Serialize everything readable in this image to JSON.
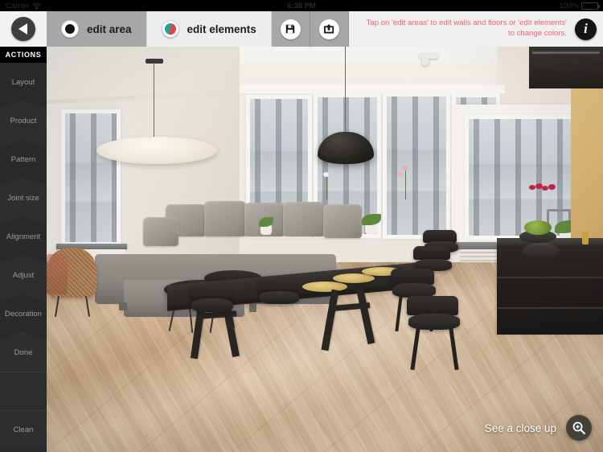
{
  "status_bar": {
    "carrier": "Carrier",
    "wifi_icon": "wifi-icon",
    "time": "6:38 PM",
    "battery_percent": "100%",
    "battery_icon": "battery-full-icon"
  },
  "toolbar": {
    "back_icon": "back-arrow-icon",
    "tabs": [
      {
        "label": "edit area",
        "icon": "black-dot-icon",
        "active": true
      },
      {
        "label": "edit elements",
        "icon": "color-wheel-icon",
        "active": false
      }
    ],
    "save_icon": "floppy-save-icon",
    "share_icon": "share-export-icon",
    "hint": "Tap on 'edit areas' to edit walls and floors or 'edit elements' to change colors.",
    "info_icon": "info-icon",
    "info_label": "i"
  },
  "sidebar": {
    "header": "ACTIONS",
    "items": [
      {
        "label": "Layout",
        "shape": "chevron"
      },
      {
        "label": "Product",
        "shape": "chevron"
      },
      {
        "label": "Pattern",
        "shape": "chevron"
      },
      {
        "label": "Joint size",
        "shape": "chevron"
      },
      {
        "label": "Alignment",
        "shape": "chevron"
      },
      {
        "label": "Adjust",
        "shape": "chevron"
      },
      {
        "label": "Decoration",
        "shape": "chevron"
      },
      {
        "label": "Done",
        "shape": "flat"
      },
      {
        "label": "Clean",
        "shape": "flat"
      }
    ]
  },
  "viewport": {
    "closeup_label": "See a close up",
    "magnifier_icon": "magnifier-icon",
    "scene": "modern-apartment-living-dining-room-with-marble-tile-floor"
  },
  "colors": {
    "accent_red": "#f4616c",
    "sidebar_bg": "#2a2a2a",
    "toolbar_active": "#a7a7a7",
    "toolbar_inactive": "#ededed",
    "floor_tone": "#d0b394"
  }
}
